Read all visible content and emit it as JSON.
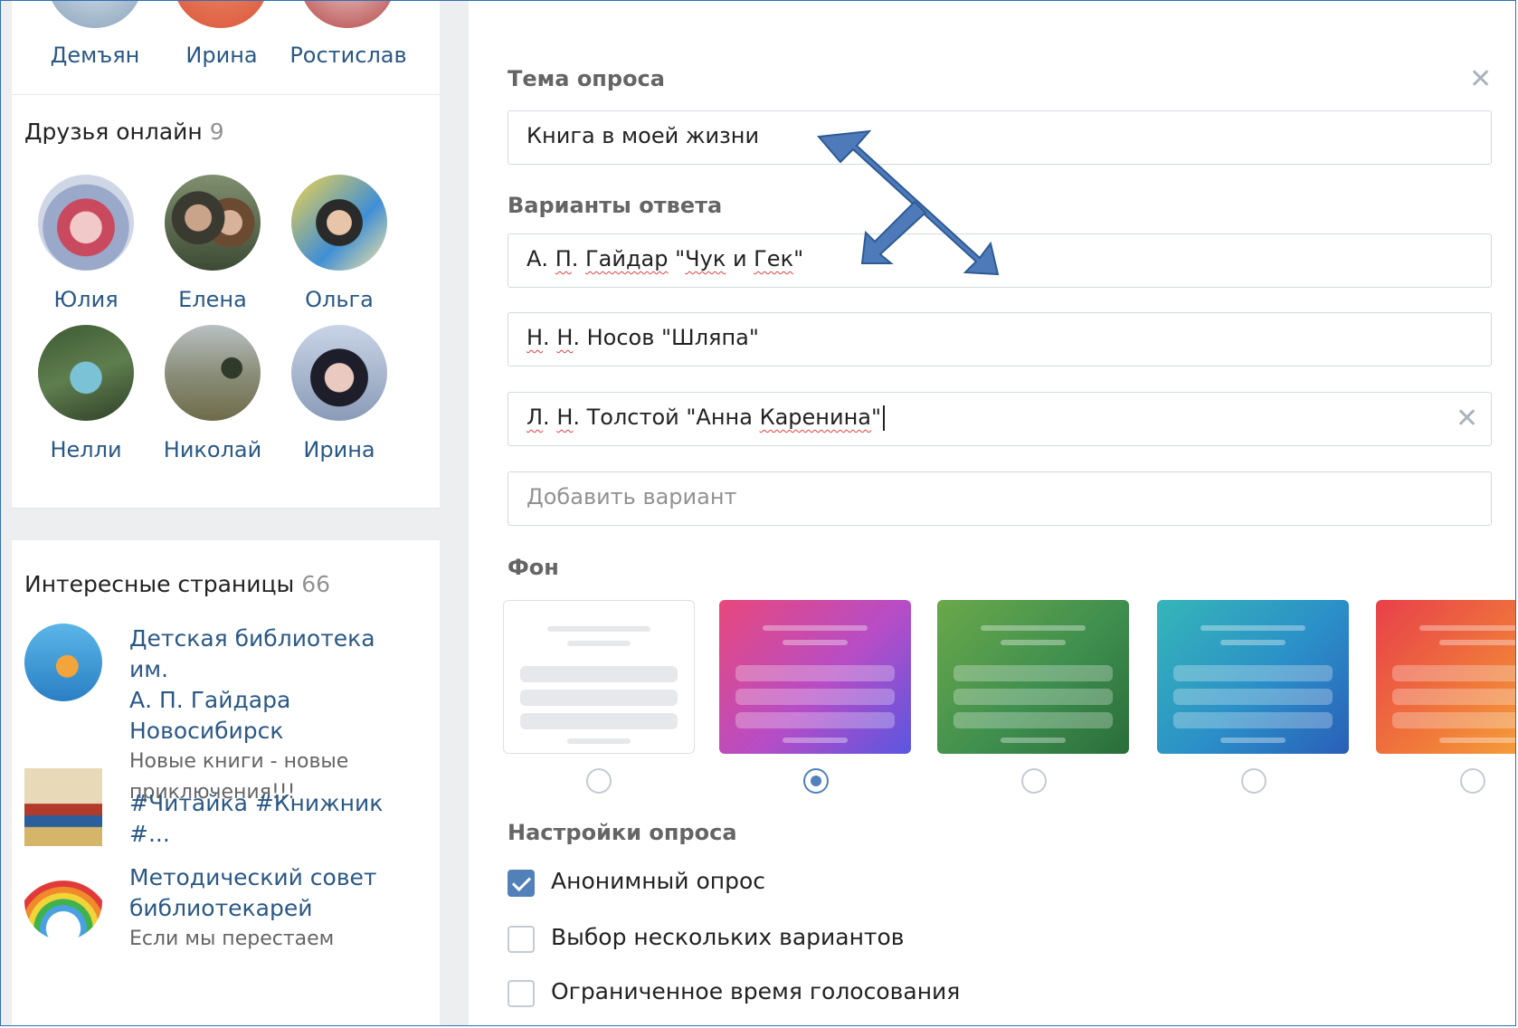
{
  "left": {
    "top_friends": [
      {
        "name": "Демъян"
      },
      {
        "name": "Ирина"
      },
      {
        "name": "Ростислав"
      }
    ],
    "friends_online": {
      "title": "Друзья онлайн",
      "count": "9",
      "items": [
        {
          "name": "Юлия"
        },
        {
          "name": "Елена"
        },
        {
          "name": "Ольга"
        },
        {
          "name": "Нелли"
        },
        {
          "name": "Николай"
        },
        {
          "name": "Ирина"
        }
      ]
    },
    "interesting_pages": {
      "title": "Интересные страницы",
      "count": "66",
      "items": [
        {
          "name_line1": "Детская библиотека им.",
          "name_line2": "А. П. Гайдара",
          "name_line3": "Новосибирск",
          "desc_line1": "Новые книги - новые",
          "desc_line2": "приключения!!!"
        },
        {
          "name_line1": "#Читайка #Книжник #..."
        },
        {
          "name_line1": "Методический совет",
          "name_line2": "библиотекарей",
          "desc_line1": "Если мы перестаем"
        }
      ]
    }
  },
  "poll": {
    "topic_label": "Тема опроса",
    "topic_value": "Книга в моей жизни",
    "options_label": "Варианты ответа",
    "options": [
      {
        "p1": "А. ",
        "p2": "П",
        "p3": ". ",
        "p4": "Гайдар",
        "p5": " \"",
        "p6": "Чук",
        "p7": " и ",
        "p8": "Гек",
        "p9": "\""
      },
      {
        "p1": "Н",
        "p2": ". ",
        "p3": "Н",
        "p4": ". Носов \"Шляпа\""
      },
      {
        "p1": "Л",
        "p2": ". ",
        "p3": "Н",
        "p4": ". Толстой \"Анна ",
        "p5": "Каренина",
        "p6": "\""
      }
    ],
    "add_option_placeholder": "Добавить вариант",
    "background_label": "Фон",
    "backgrounds": [
      {
        "name": "white",
        "selected": false
      },
      {
        "name": "pink-purple",
        "selected": true
      },
      {
        "name": "green",
        "selected": false
      },
      {
        "name": "teal-blue",
        "selected": false
      },
      {
        "name": "red-orange",
        "selected": false
      }
    ],
    "settings_label": "Настройки опроса",
    "settings": [
      {
        "label": "Анонимный опрос",
        "checked": true
      },
      {
        "label": "Выбор нескольких вариантов",
        "checked": false
      },
      {
        "label": "Ограниченное время голосования",
        "checked": false
      }
    ],
    "close_glyph": "✕"
  },
  "colors": {
    "link": "#2a5885",
    "accent": "#5181b8",
    "annotation_arrow": "#4f7ab9"
  }
}
